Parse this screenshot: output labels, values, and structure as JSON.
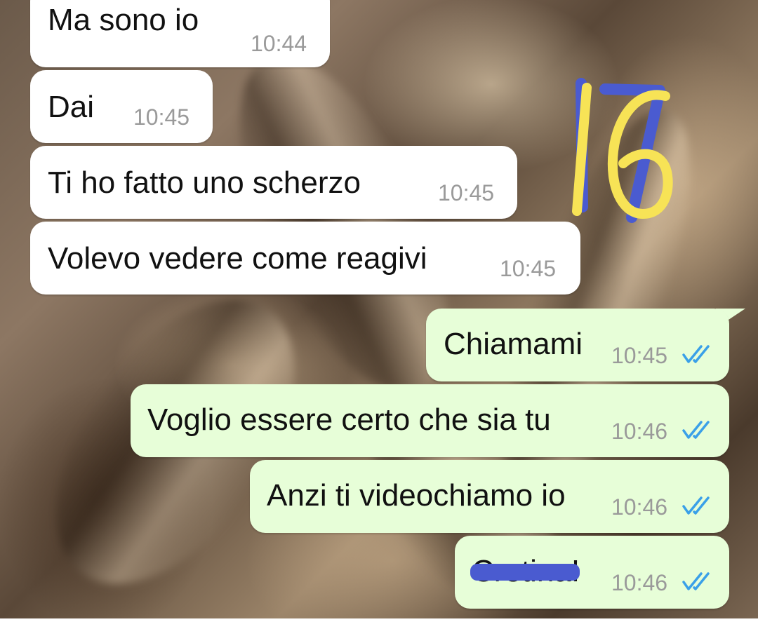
{
  "chat": {
    "incoming": [
      {
        "text": "Ma sono io",
        "time": "10:44"
      },
      {
        "text": "Dai",
        "time": "10:45"
      },
      {
        "text": "Ti ho fatto uno scherzo",
        "time": "10:45"
      },
      {
        "text": "Volevo vedere come reagivi",
        "time": "10:45"
      }
    ],
    "outgoing": [
      {
        "text": "Chiamami",
        "time": "10:45",
        "status": "read"
      },
      {
        "text": "Voglio essere certo che sia tu",
        "time": "10:46",
        "status": "read"
      },
      {
        "text": "Anzi ti videochiamo io",
        "time": "10:46",
        "status": "read"
      },
      {
        "text": "Cretina!",
        "time": "10:46",
        "status": "read",
        "partially_redacted": true
      }
    ]
  },
  "annotation": {
    "yellow_number": "16",
    "blue_number": "17",
    "yellow_color": "#f7e356",
    "blue_color": "#4a5bd0"
  },
  "colors": {
    "incoming_bubble": "#ffffff",
    "outgoing_bubble": "#e7fed8",
    "read_tick": "#3aa0e8",
    "time_text": "#9a9a9a"
  },
  "icons": {
    "read_receipt": "double-check-icon"
  }
}
